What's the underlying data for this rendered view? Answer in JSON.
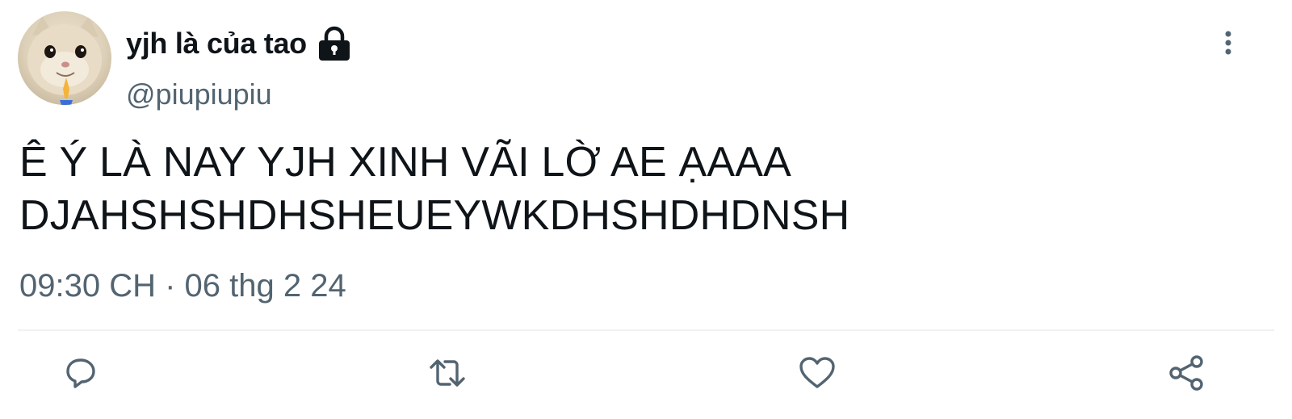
{
  "author": {
    "display_name": "yjh là của tao",
    "handle": "@piupiupiu",
    "avatar": "cat-avatar",
    "protected_icon": "lock-icon"
  },
  "tweet": {
    "text_lines": [
      "Ê Ý LÀ NAY YJH XINH VÃI LỜ AE ẠAAA",
      "DJAHSHSHDHSHEUEYWKDHSHDHDNSH"
    ],
    "timestamp": "09:30 CH · 06 thg 2 24"
  },
  "actions": {
    "reply_icon": "reply-icon",
    "retweet_icon": "retweet-icon",
    "like_icon": "heart-icon",
    "share_icon": "share-icon",
    "more_icon": "more-vertical-icon"
  },
  "colors": {
    "text": "#0f1419",
    "secondary": "#536471",
    "divider": "#eff3f4"
  }
}
